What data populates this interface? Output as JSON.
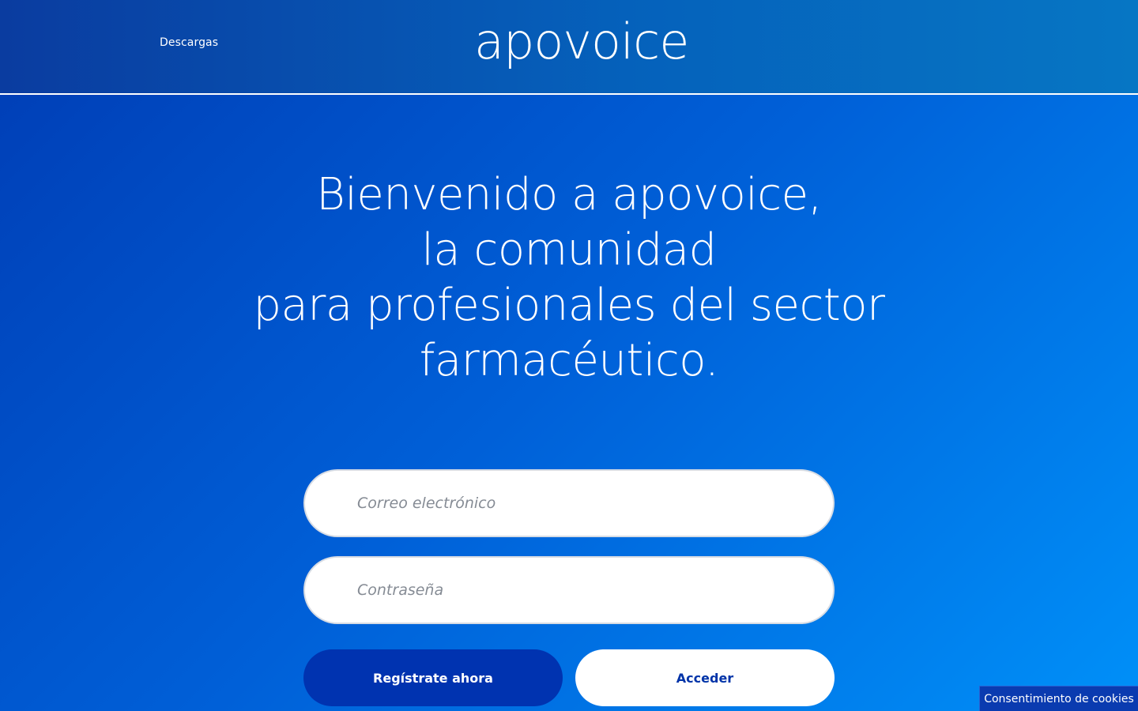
{
  "header": {
    "nav_downloads": "Descargas",
    "logo_text": "apovoice"
  },
  "hero": {
    "lines": [
      "Bienvenido a apovoice,",
      "la comunidad",
      "para profesionales del sector",
      "farmacéutico."
    ]
  },
  "login_form": {
    "email": {
      "placeholder": "Correo electrónico",
      "value": ""
    },
    "password": {
      "placeholder": "Contraseña",
      "value": ""
    },
    "register_label": "Regístrate ahora",
    "login_label": "Acceder"
  },
  "cookie_banner": {
    "label": "Consentimiento de cookies"
  },
  "colors": {
    "primary_blue": "#0033b0",
    "gradient_start": "#003cb4",
    "gradient_end": "#0090f8",
    "white": "#ffffff"
  }
}
